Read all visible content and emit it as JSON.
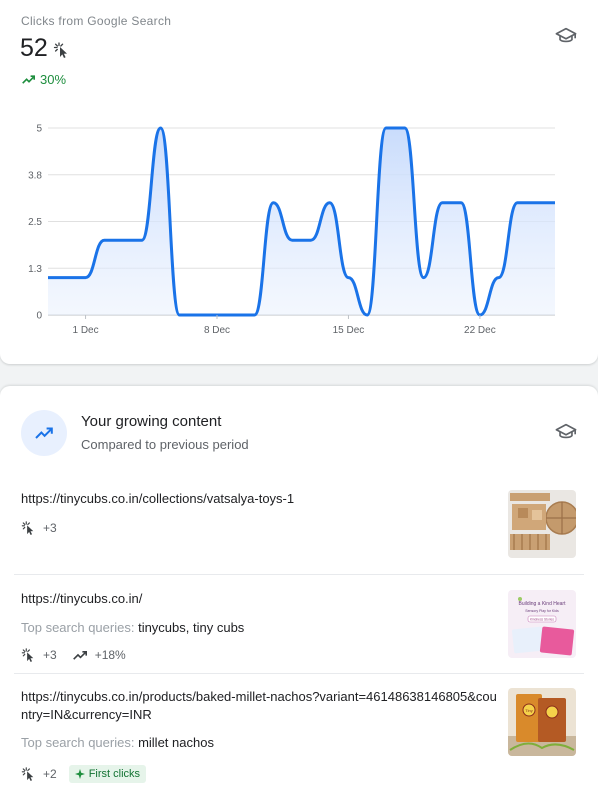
{
  "clicks_card": {
    "label": "Clicks from Google Search",
    "value": "52",
    "trend": "30%",
    "icons": {
      "clicks": "cursor-click-icon",
      "trend": "trending-up-icon",
      "learn": "school-cap-icon"
    }
  },
  "chart_data": {
    "type": "area",
    "x_ticks": [
      "1 Dec",
      "8 Dec",
      "15 Dec",
      "22 Dec"
    ],
    "y_ticks": [
      "0",
      "1.3",
      "2.5",
      "3.8",
      "5"
    ],
    "ylim": [
      0,
      5
    ],
    "grid": true,
    "x": [
      "29 Nov",
      "30 Nov",
      "1 Dec",
      "2 Dec",
      "3 Dec",
      "4 Dec",
      "5 Dec",
      "6 Dec",
      "7 Dec",
      "8 Dec",
      "9 Dec",
      "10 Dec",
      "11 Dec",
      "12 Dec",
      "13 Dec",
      "14 Dec",
      "15 Dec",
      "16 Dec",
      "17 Dec",
      "18 Dec",
      "19 Dec",
      "20 Dec",
      "21 Dec",
      "22 Dec",
      "23 Dec",
      "24 Dec",
      "25 Dec",
      "26 Dec"
    ],
    "values": [
      1,
      1,
      1,
      2,
      2,
      2,
      5,
      0,
      0,
      0,
      0,
      0,
      3,
      2,
      2,
      3,
      1,
      0,
      5,
      5,
      1,
      3,
      3,
      0,
      1,
      3,
      3,
      3
    ],
    "color": "#1a73e8"
  },
  "growing": {
    "title": "Your growing content",
    "subtitle": "Compared to previous period",
    "queries_label": "Top search queries:",
    "first_clicks": "First clicks",
    "items": [
      {
        "url": "https://tinycubs.co.in/collections/vatsalya-toys-1",
        "clicks": "+3"
      },
      {
        "url": "https://tinycubs.co.in/",
        "queries": "tinycubs, tiny cubs",
        "clicks": "+3",
        "change": "+18%"
      },
      {
        "url": "https://tinycubs.co.in/products/baked-millet-nachos?variant=46148638146805&country=IN&currency=INR",
        "queries": "millet nachos",
        "clicks": "+2"
      }
    ]
  },
  "thumb2": {
    "line1": "Building a Kind Heart",
    "line2": "Sensory Play for Kids",
    "line3": "Kindness Stories"
  },
  "thumb3": {
    "line1": "Tiny"
  }
}
